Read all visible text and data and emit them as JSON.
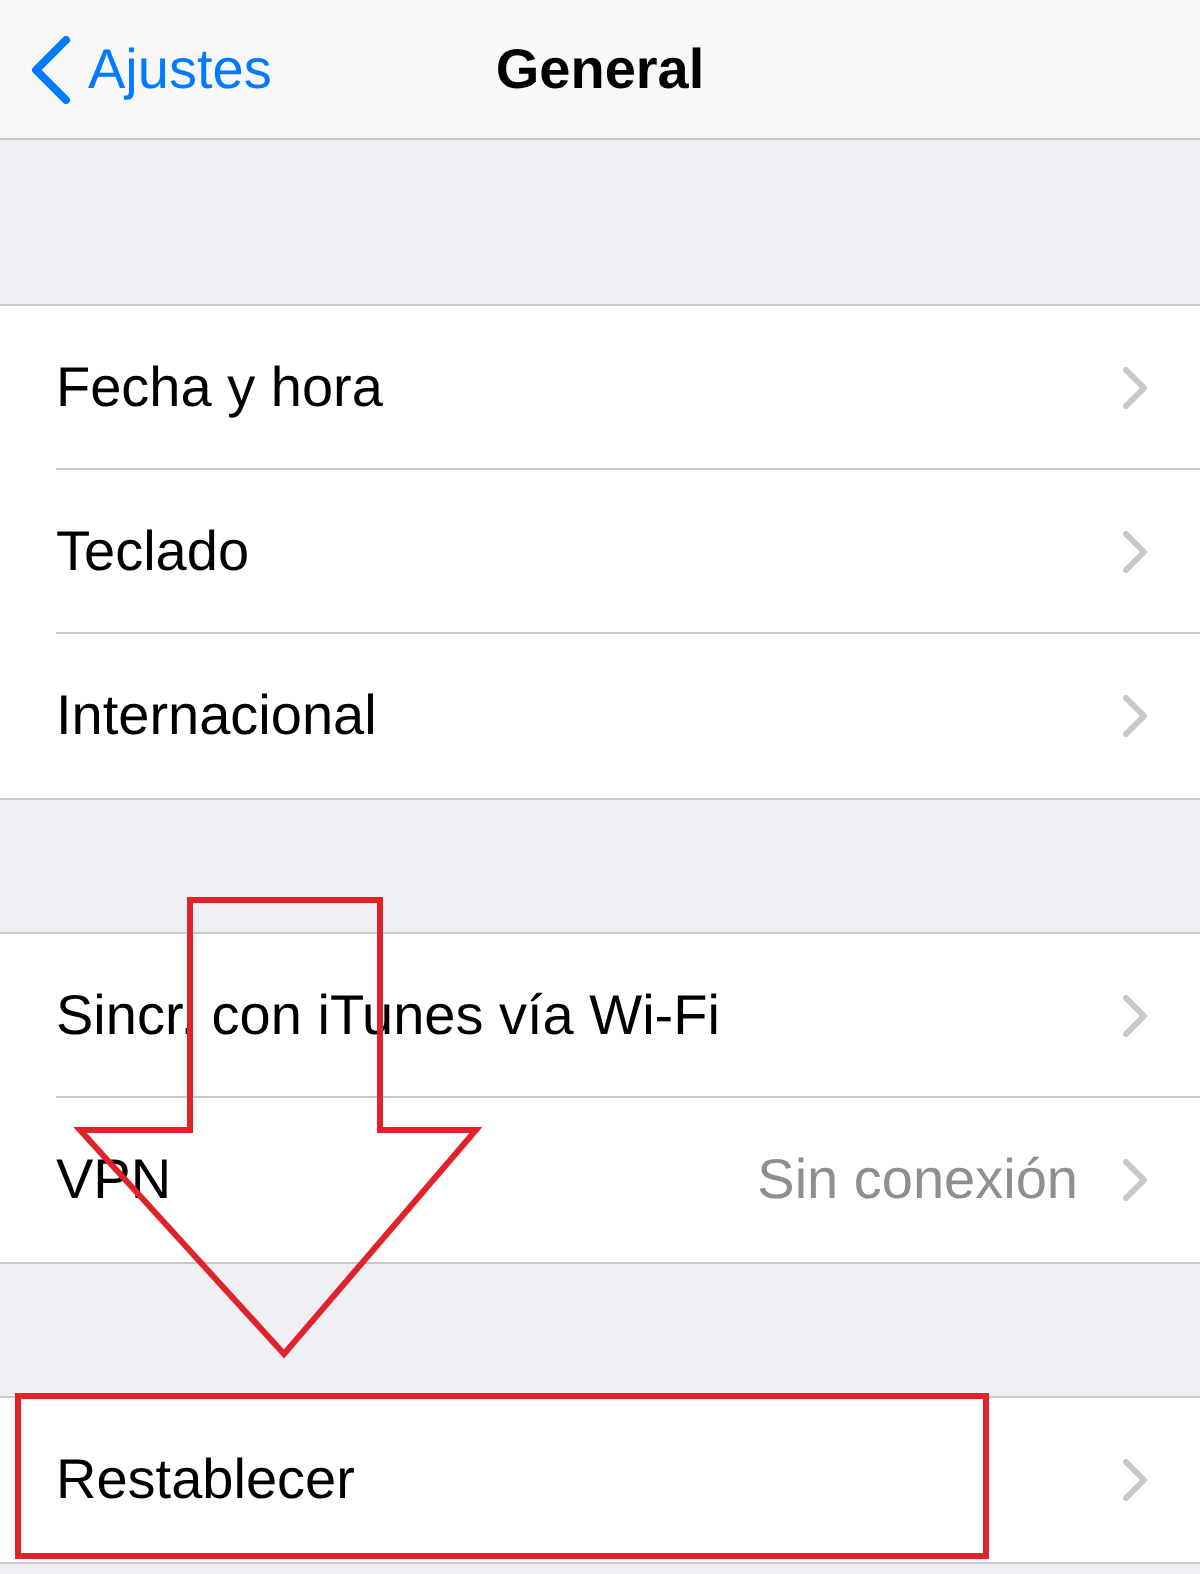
{
  "nav_bar": {
    "back_label": "Ajustes",
    "title": "General"
  },
  "groups": [
    {
      "rows": [
        {
          "label": "Fecha y hora"
        },
        {
          "label": "Teclado"
        },
        {
          "label": "Internacional"
        }
      ]
    },
    {
      "rows": [
        {
          "label": "Sincr. con iTunes vía Wi-Fi"
        },
        {
          "label": "VPN",
          "detail": "Sin conexión"
        }
      ]
    },
    {
      "rows": [
        {
          "label": "Restablecer"
        }
      ]
    }
  ]
}
